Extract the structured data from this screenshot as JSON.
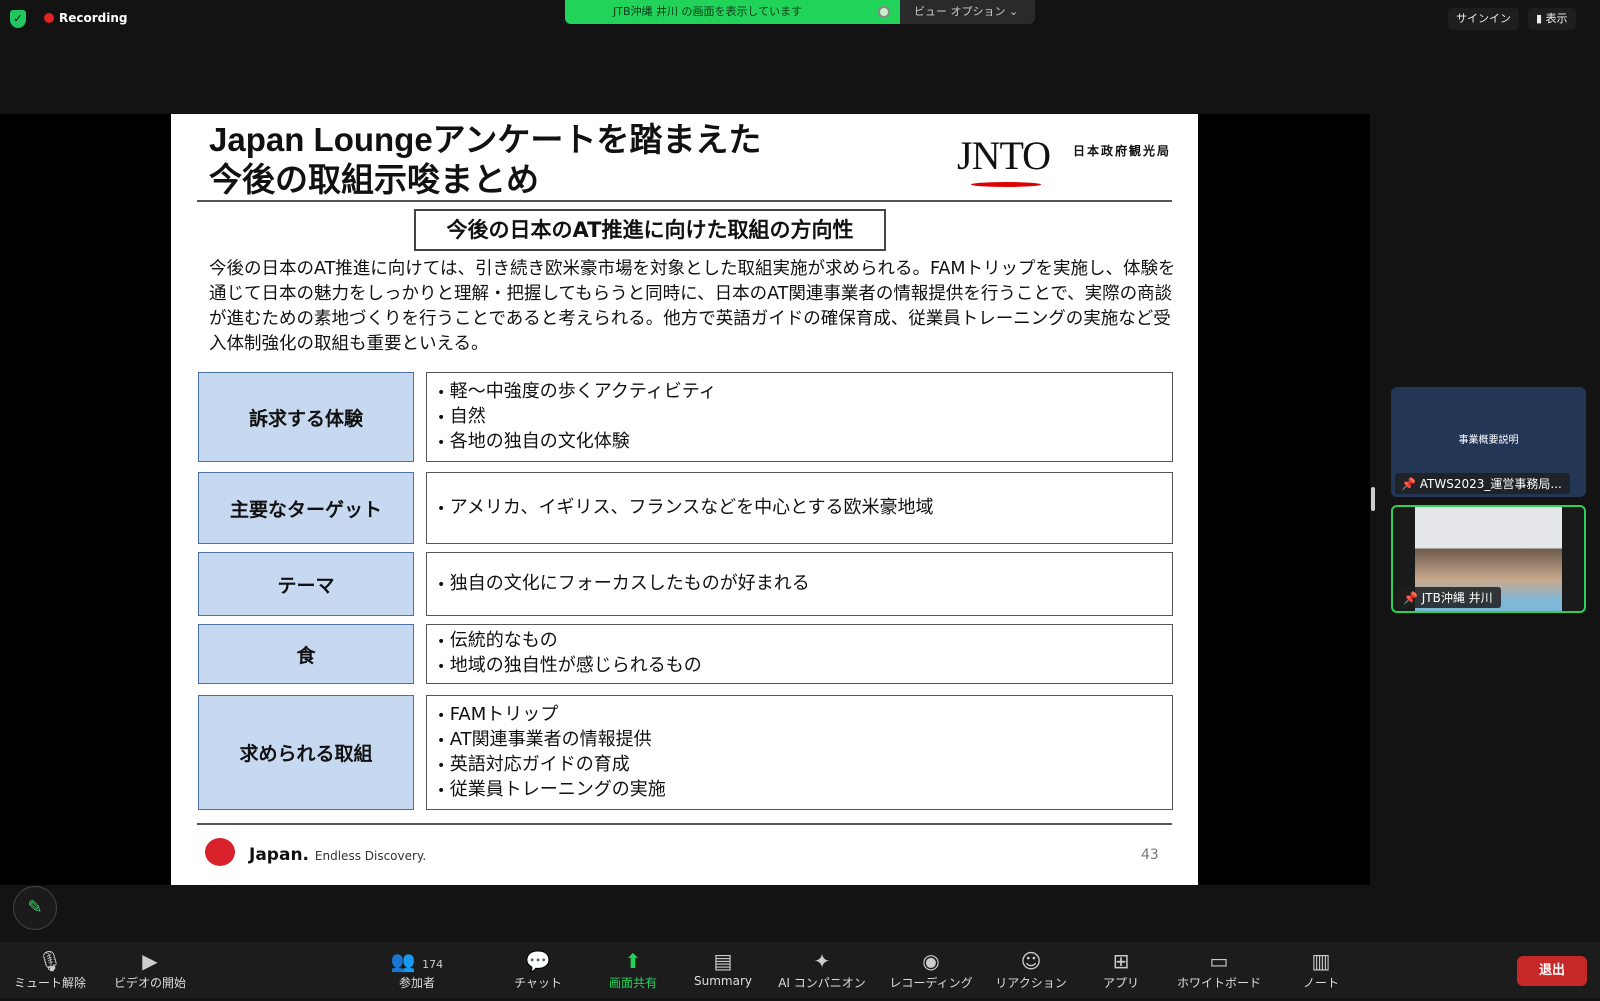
{
  "topbar": {
    "recording": "Recording",
    "share_banner": "JTB沖縄 井川 の画面を表示しています",
    "view_options": "ビュー オプション ⌄",
    "signin": "サインイン",
    "view": "表示"
  },
  "slide": {
    "title_line1": "Japan Loungeアンケートを踏まえた",
    "title_line2": "今後の取組示唆まとめ",
    "logo": "JNTO",
    "logo_jp": "日本政府観光局",
    "subtitle": "今後の日本のAT推進に向けた取組の方向性",
    "intro": "今後の日本のAT推進に向けては、引き続き欧米豪市場を対象とした取組実施が求められる。FAMトリップを実施し、体験を通じて日本の魅力をしっかりと理解・把握してもらうと同時に、日本のAT関連事業者の情報提供を行うことで、実際の商談が進むための素地づくりを行うことであると考えられる。他方で英語ガイドの確保育成、従業員トレーニングの実施など受入体制強化の取組も重要といえる。",
    "rows": [
      {
        "label": "訴求する体験",
        "items": [
          "軽～中強度の歩くアクティビティ",
          "自然",
          "各地の独自の文化体験"
        ]
      },
      {
        "label": "主要なターゲット",
        "items": [
          "アメリカ、イギリス、フランスなどを中心とする欧米豪地域"
        ]
      },
      {
        "label": "テーマ",
        "items": [
          "独自の文化にフォーカスしたものが好まれる"
        ]
      },
      {
        "label": "食",
        "items": [
          "伝統的なもの",
          "地域の独自性が感じられるもの"
        ]
      },
      {
        "label": "求められる取組",
        "items": [
          "FAMトリップ",
          "AT関連事業者の情報提供",
          "英語対応ガイドの育成",
          "従業員トレーニングの実施"
        ]
      }
    ],
    "footer_brand": "Japan.",
    "footer_tagline": "Endless Discovery.",
    "page_number": "43"
  },
  "participants": [
    {
      "name": "ATWS2023_運営事務局...",
      "thumb_title": "事業概要説明"
    },
    {
      "name": "JTB沖縄 井川"
    }
  ],
  "toolbar": {
    "items": [
      {
        "label": "ミュート解除",
        "icon": "mic-off-icon"
      },
      {
        "label": "ビデオの開始",
        "icon": "video-off-icon"
      },
      {
        "label": "参加者",
        "icon": "participants-icon",
        "count": "174"
      },
      {
        "label": "チャット",
        "icon": "chat-icon"
      },
      {
        "label": "画面共有",
        "icon": "share-screen-icon"
      },
      {
        "label": "Summary",
        "icon": "summary-icon"
      },
      {
        "label": "AI コンパニオン",
        "icon": "ai-sparkle-icon"
      },
      {
        "label": "レコーディング",
        "icon": "record-icon"
      },
      {
        "label": "リアクション",
        "icon": "reaction-icon"
      },
      {
        "label": "アプリ",
        "icon": "apps-icon"
      },
      {
        "label": "ホワイトボード",
        "icon": "whiteboard-icon"
      },
      {
        "label": "ノート",
        "icon": "notes-icon"
      }
    ],
    "leave": "退出"
  },
  "colors": {
    "accent_green": "#22d35a",
    "label_fill": "#c6d9f1",
    "leave_red": "#c62828"
  }
}
